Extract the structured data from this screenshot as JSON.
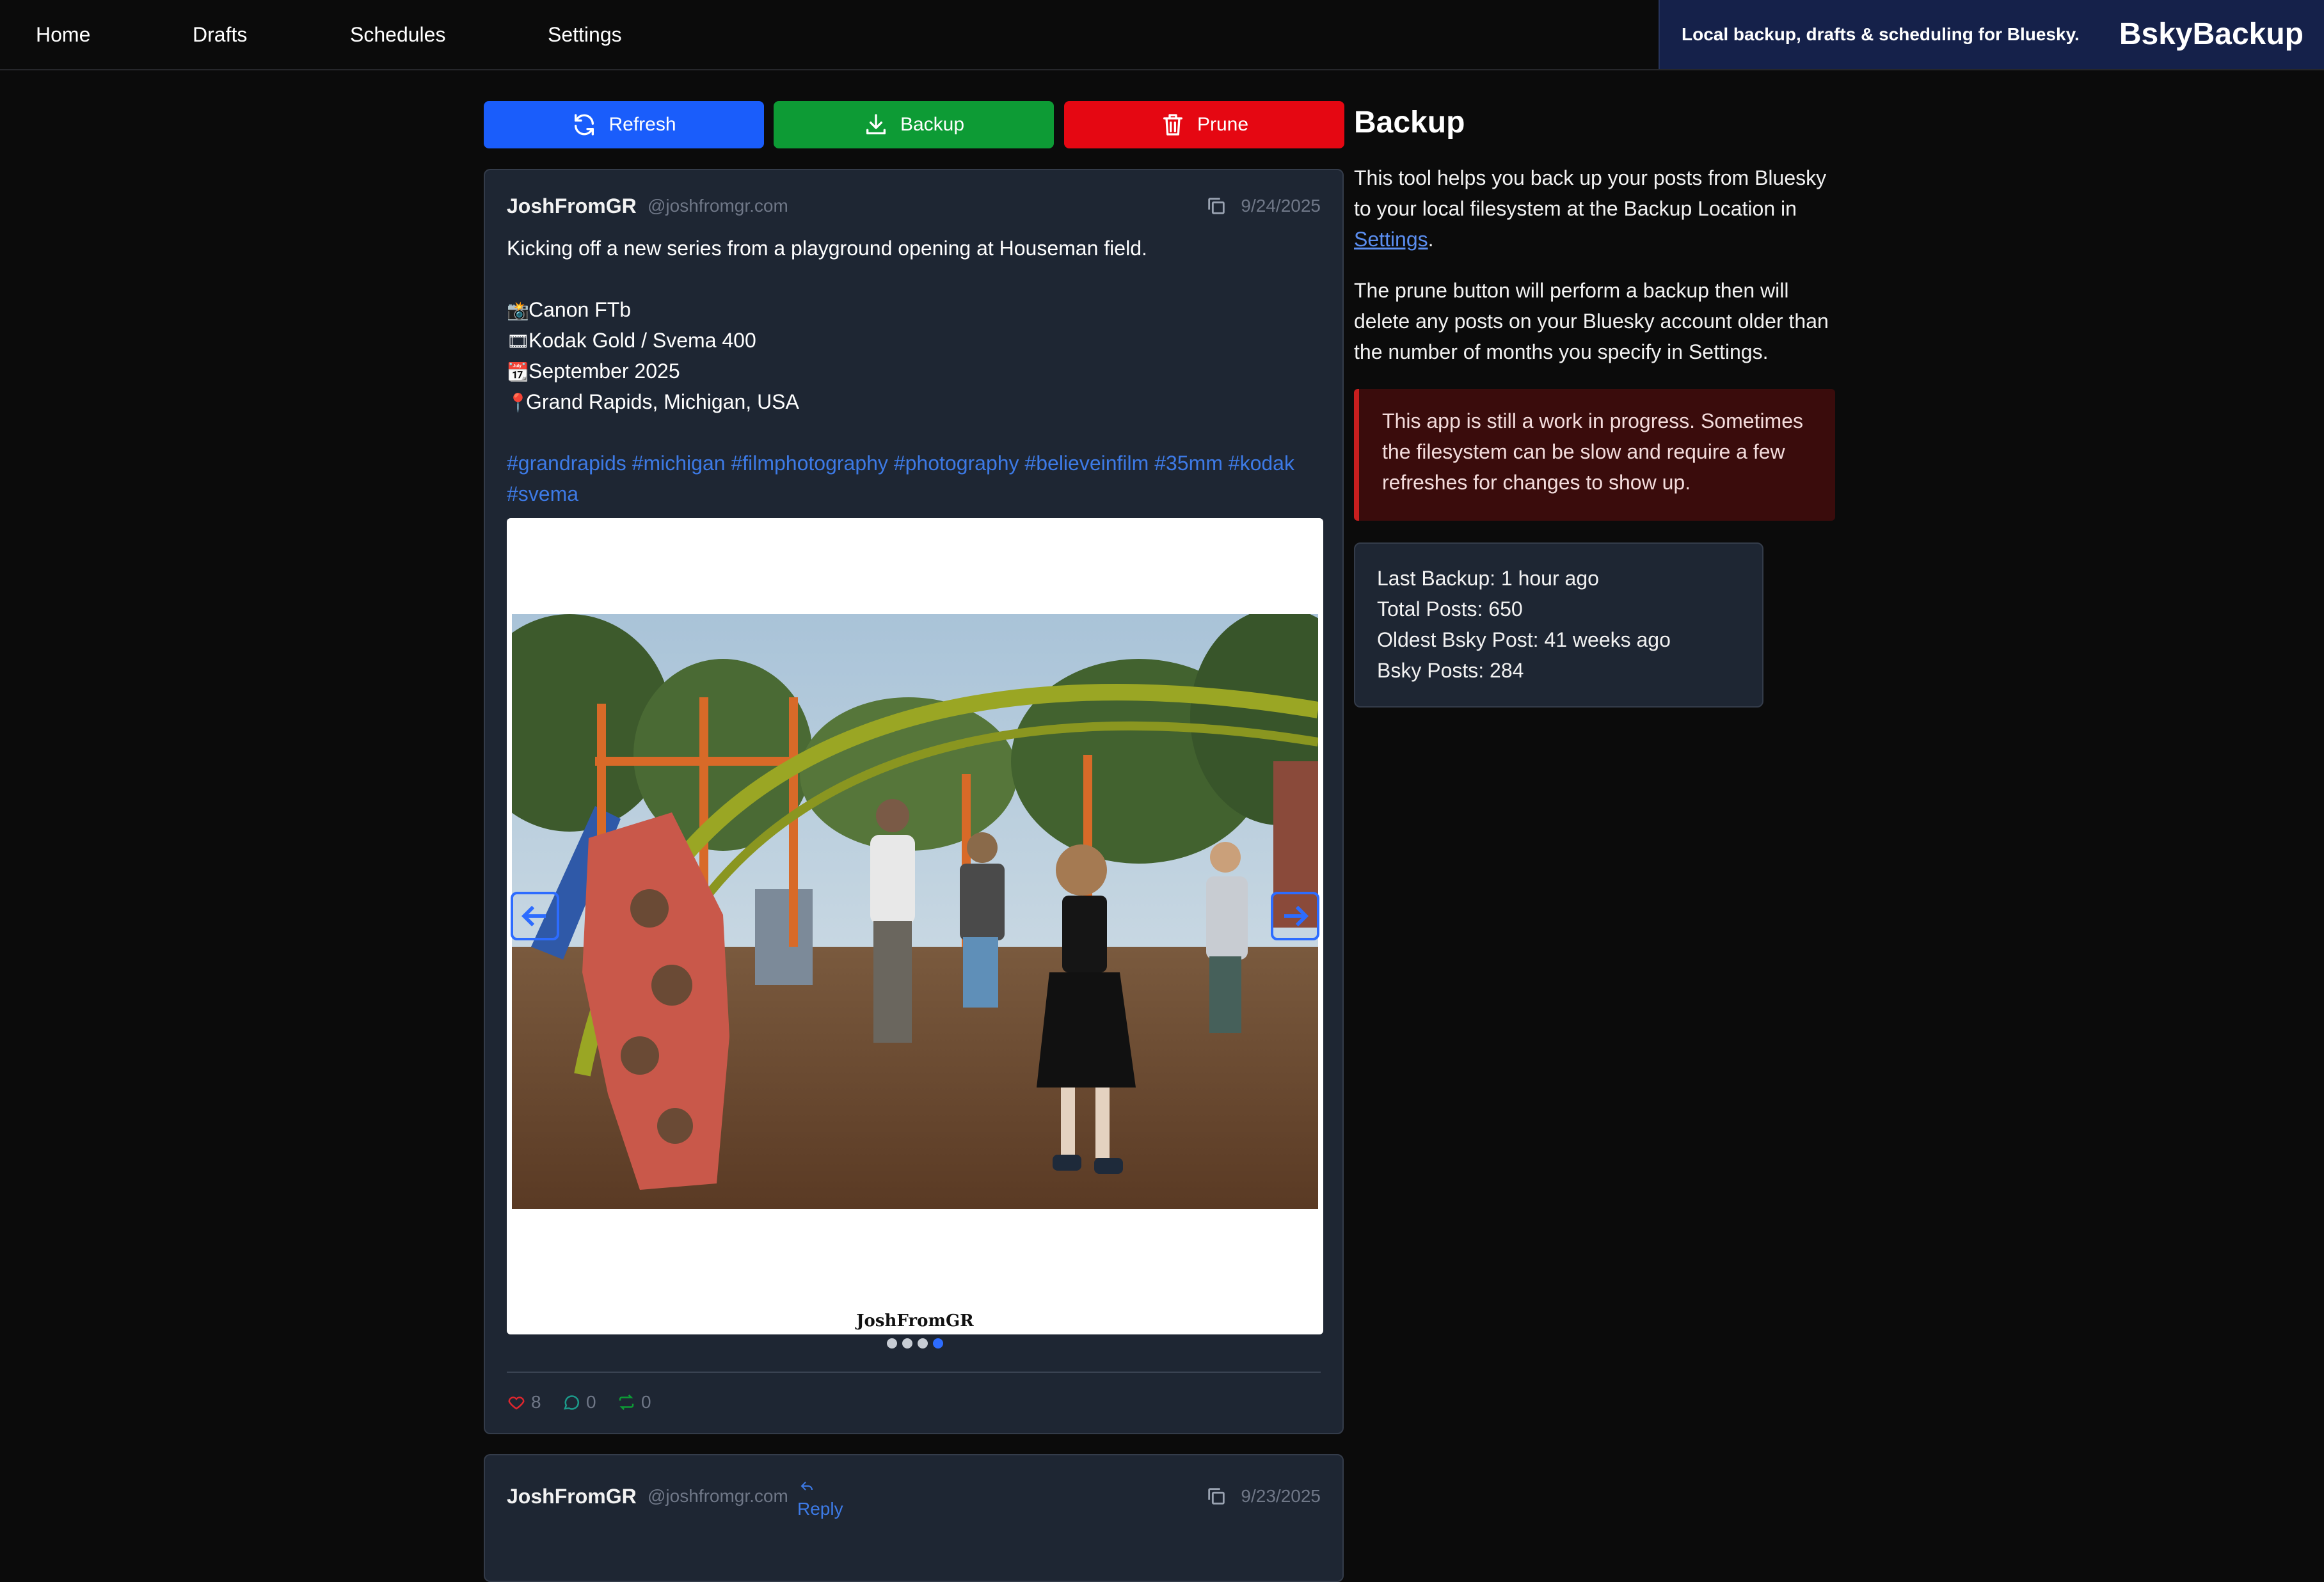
{
  "nav": {
    "links": [
      "Home",
      "Drafts",
      "Schedules",
      "Settings"
    ],
    "tagline": "Local backup, drafts & scheduling for Bluesky.",
    "brand": "BskyBackup"
  },
  "actions": {
    "refresh_label": "Refresh",
    "backup_label": "Backup",
    "prune_label": "Prune"
  },
  "posts": [
    {
      "author": "JoshFromGR",
      "handle": "@joshfromgr.com",
      "date": "9/24/2025",
      "text": "Kicking off a new series from a playground opening at Houseman field.",
      "details": [
        "Canon FTb",
        "Kodak Gold / Svema 400",
        "September 2025",
        "Grand Rapids, Michigan, USA"
      ],
      "detail_icons": [
        "camera-icon",
        "film-icon",
        "calendar-icon",
        "pin-icon"
      ],
      "tags_line1": "#grandrapids #michigan #filmphotography #photography #believeinfilm #35mm #kodak",
      "tags_line2": "#svema",
      "image_watermark": "JoshFromGR",
      "image_count": 4,
      "active_image": 4,
      "likes": "8",
      "replies": "0",
      "reposts": "0"
    },
    {
      "author": "JoshFromGR",
      "handle": "@joshfromgr.com",
      "reply_label": "Reply",
      "date": "9/23/2025"
    }
  ],
  "sidebar": {
    "title": "Backup",
    "para1_a": "This tool helps you back up your posts from Bluesky",
    "para1_b": "to your local filesystem at the Backup Location in",
    "para1_link": "Settings",
    "para2_a": "The prune button will perform a backup then will",
    "para2_b": "delete any posts on your Bluesky account older than",
    "para2_c": "the number of months you specify in Settings.",
    "warning_a": "This app is still a work in progress. Sometimes",
    "warning_b": "the filesystem can be slow and require a few",
    "warning_c": "refreshes for changes to show up.",
    "stats": {
      "last_backup": "Last Backup: 1 hour ago",
      "total_posts": "Total Posts: 650",
      "oldest_post": "Oldest Bsky Post: 41 weeks ago",
      "bsky_posts": "Bsky Posts: 284"
    }
  },
  "colors": {
    "background": "#0b0b0b",
    "card": "#1e2633",
    "refresh": "#1a5dfb",
    "backup": "#0d9b35",
    "prune": "#e50712",
    "hashtag": "#3d7ae6",
    "warning_bg": "#3a0c0c",
    "warning_border": "#c81e1e"
  }
}
